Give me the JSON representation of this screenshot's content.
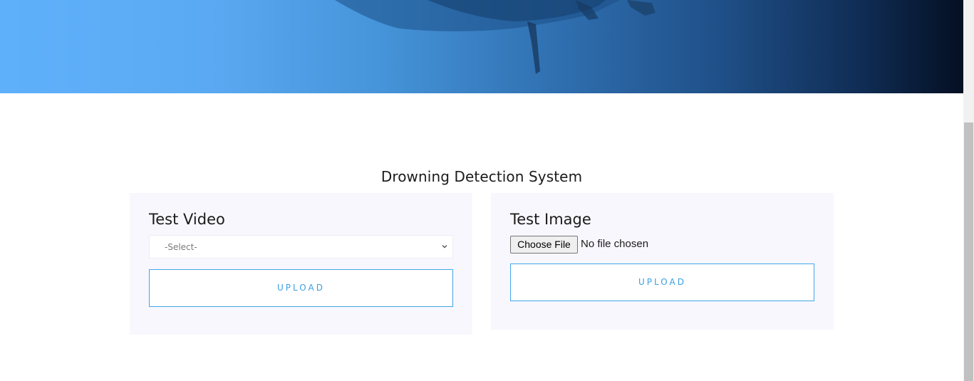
{
  "hero": {
    "colors": {
      "left": "#5fb0fb",
      "right": "#040f22"
    }
  },
  "main": {
    "title": "Drowning Detection System"
  },
  "video_card": {
    "heading": "Test Video",
    "select": {
      "selected": "-Select-"
    },
    "upload_label": "UPLOAD"
  },
  "image_card": {
    "heading": "Test Image",
    "choose_file_label": "Choose File",
    "file_status": "No file chosen",
    "upload_label": "UPLOAD"
  },
  "colors": {
    "accent": "#3a9fe2",
    "card_background": "#f9f7fe"
  }
}
